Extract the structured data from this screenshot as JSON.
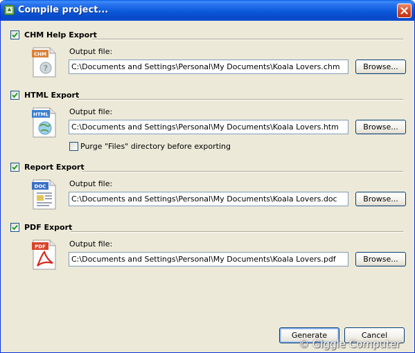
{
  "window": {
    "title": "Compile project..."
  },
  "sections": [
    {
      "title": "CHM Help Export",
      "checked": true,
      "icon": "chm-file-icon",
      "icon_tag": "CHM",
      "tag_color": "#d9823b",
      "output_label": "Output file:",
      "output_value": "C:\\Documents and Settings\\Personal\\My Documents\\Koala Lovers.chm",
      "browse_label": "Browse..."
    },
    {
      "title": "HTML Export",
      "checked": true,
      "icon": "html-file-icon",
      "icon_tag": "HTML",
      "tag_color": "#3a7fd0",
      "output_label": "Output file:",
      "output_value": "C:\\Documents and Settings\\Personal\\My Documents\\Koala Lovers.htm",
      "browse_label": "Browse...",
      "purge_label": "Purge \"Files\" directory before exporting",
      "purge_checked": false
    },
    {
      "title": "Report Export",
      "checked": true,
      "icon": "doc-file-icon",
      "icon_tag": "DOC",
      "tag_color": "#3b6fc4",
      "output_label": "Output file:",
      "output_value": "C:\\Documents and Settings\\Personal\\My Documents\\Koala Lovers.doc",
      "browse_label": "Browse..."
    },
    {
      "title": "PDF Export",
      "checked": true,
      "icon": "pdf-file-icon",
      "icon_tag": "PDF",
      "tag_color": "#d8442a",
      "output_label": "Output file:",
      "output_value": "C:\\Documents and Settings\\Personal\\My Documents\\Koala Lovers.pdf",
      "browse_label": "Browse..."
    }
  ],
  "buttons": {
    "generate": "Generate",
    "cancel": "Cancel"
  },
  "watermark": "© Giggle Computer",
  "colors": {
    "titlebar": "#0b5ad9",
    "close": "#d2411e",
    "dialog_bg": "#ece9d8",
    "check": "#21a121"
  }
}
